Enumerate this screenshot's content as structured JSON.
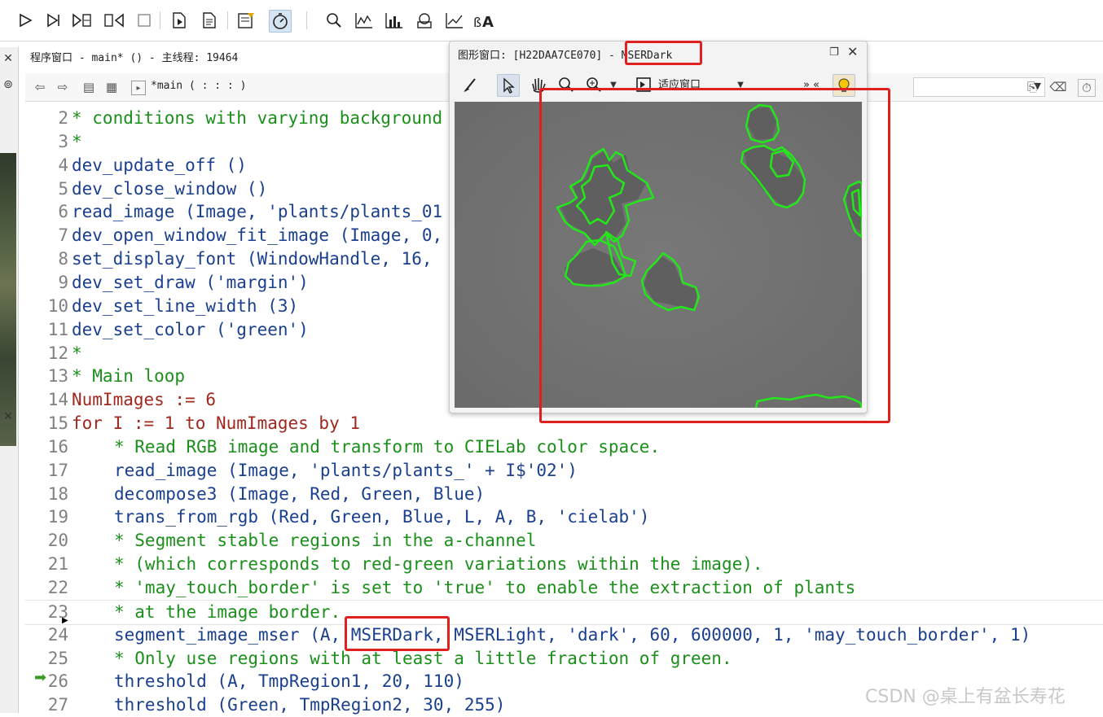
{
  "toolbar": {
    "buttons": [
      {
        "icon": "run-icon"
      },
      {
        "icon": "step-over-icon"
      },
      {
        "icon": "step-into-icon"
      },
      {
        "icon": "step-out-icon"
      },
      {
        "icon": "stop-icon"
      },
      {
        "icon": "reset-program-icon"
      },
      {
        "icon": "reset-all-icon"
      },
      {
        "icon": "assistant-icon"
      },
      {
        "icon": "profiler-icon"
      },
      {
        "icon": "zoom-icon"
      },
      {
        "icon": "histogram-icon"
      },
      {
        "icon": "line-profile-icon"
      },
      {
        "icon": "feature-inspection-icon"
      },
      {
        "icon": "plot-icon"
      },
      {
        "icon": "ocr-icon"
      }
    ]
  },
  "program_window": {
    "title": "程序窗口 - main* () - 主线程: 19464",
    "procedure": "*main ( : : : )"
  },
  "graphics_window": {
    "title_prefix": "图形窗口: [H22DAA7CE070] - ",
    "title_name": "MSERDark",
    "fit_label": "适应窗口",
    "more_label": "» «"
  },
  "code_lines": [
    {
      "n": "2",
      "text": "* conditions with varying background",
      "kind": "comment",
      "indent": 0
    },
    {
      "n": "3",
      "text": "*",
      "kind": "comment",
      "indent": 0
    },
    {
      "n": "4",
      "text": "dev_update_off ()",
      "kind": "op",
      "indent": 0
    },
    {
      "n": "5",
      "text": "dev_close_window ()",
      "kind": "op",
      "indent": 0
    },
    {
      "n": "6",
      "text": "read_image (Image, 'plants/plants_01",
      "kind": "op",
      "indent": 0
    },
    {
      "n": "7",
      "text": "dev_open_window_fit_image (Image, 0,",
      "kind": "op",
      "indent": 0
    },
    {
      "n": "8",
      "text": "set_display_font (WindowHandle, 16,",
      "kind": "op",
      "indent": 0
    },
    {
      "n": "9",
      "text": "dev_set_draw ('margin')",
      "kind": "op",
      "indent": 0
    },
    {
      "n": "10",
      "text": "dev_set_line_width (3)",
      "kind": "op",
      "indent": 0
    },
    {
      "n": "11",
      "text": "dev_set_color ('green')",
      "kind": "op",
      "indent": 0
    },
    {
      "n": "12",
      "text": "*",
      "kind": "comment",
      "indent": 0
    },
    {
      "n": "13",
      "text": "* Main loop",
      "kind": "comment",
      "indent": 0
    },
    {
      "n": "14",
      "text": "NumImages := 6",
      "kind": "ctl",
      "indent": 0
    },
    {
      "n": "15",
      "text": "for I := 1 to NumImages by 1",
      "kind": "ctl",
      "indent": 0
    },
    {
      "n": "16",
      "text": "* Read RGB image and transform to CIELab color space.",
      "kind": "comment",
      "indent": 1
    },
    {
      "n": "17",
      "text": "read_image (Image, 'plants/plants_' + I$'02')",
      "kind": "op",
      "indent": 1
    },
    {
      "n": "18",
      "text": "decompose3 (Image, Red, Green, Blue)",
      "kind": "op",
      "indent": 1
    },
    {
      "n": "19",
      "text": "trans_from_rgb (Red, Green, Blue, L, A, B, 'cielab')",
      "kind": "op",
      "indent": 1
    },
    {
      "n": "20",
      "text": "* Segment stable regions in the a-channel",
      "kind": "comment",
      "indent": 1
    },
    {
      "n": "21",
      "text": "* (which corresponds to red-green variations within the image).",
      "kind": "comment",
      "indent": 1
    },
    {
      "n": "22",
      "text": "* 'may_touch_border' is set to 'true' to enable the extraction of plants",
      "kind": "comment",
      "indent": 1
    },
    {
      "n": "23",
      "text": "* at the image border.",
      "kind": "comment",
      "indent": 1
    },
    {
      "n": "24",
      "text": "segment_image_mser (A, MSERDark, MSERLight, 'dark', 60, 600000, 1, 'may_touch_border', 1)",
      "kind": "op",
      "indent": 1
    },
    {
      "n": "25",
      "text": "* Only use regions with at least a little fraction of green.",
      "kind": "comment",
      "indent": 1
    },
    {
      "n": "26",
      "text": "threshold (A, TmpRegion1, 20, 110)",
      "kind": "op",
      "indent": 1
    },
    {
      "n": "27",
      "text": "threshold (Green, TmpRegion2, 30, 255)",
      "kind": "op",
      "indent": 1
    }
  ],
  "colors": {
    "comment": "#1a8f1a",
    "operator": "#1a3f8f",
    "control": "#a0281e",
    "annotation": "#e0201e",
    "region": "#22e81a"
  },
  "watermark": "CSDN @桌上有盆长寿花"
}
